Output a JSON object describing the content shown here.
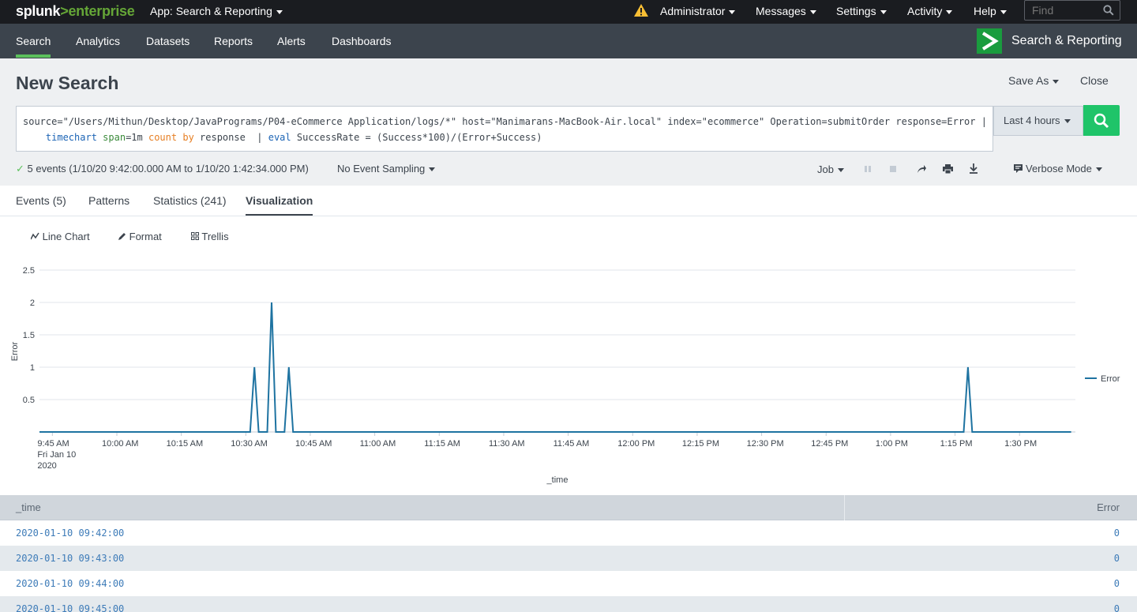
{
  "topbar": {
    "logo_splunk": "splunk",
    "logo_arrow": ">",
    "logo_enterprise": "enterprise",
    "app_label": "App: Search & Reporting",
    "menus": [
      "Administrator",
      "Messages",
      "Settings",
      "Activity",
      "Help"
    ],
    "find_placeholder": "Find",
    "warning_color": "#f8be34"
  },
  "appbar": {
    "nav": [
      "Search",
      "Analytics",
      "Datasets",
      "Reports",
      "Alerts",
      "Dashboards"
    ],
    "active_nav": "Search",
    "app_title": "Search & Reporting",
    "app_icon_color": "#1a9c3e"
  },
  "header": {
    "title": "New Search",
    "save_as": "Save As",
    "close": "Close"
  },
  "search": {
    "line1": "source=\"/Users/Mithun/Desktop/JavaPrograms/P04-eCommerce Application/logs/*\" host=\"Manimarans-MacBook-Air.local\" index=\"ecommerce\" Operation=submitOrder response=Error |",
    "line2_cmd1": "timechart",
    "line2_arg1": "span",
    "line2_val1": "=1m ",
    "line2_fn": "count",
    "line2_by": "by",
    "line2_rest1": " response  | ",
    "line2_cmd2": "eval",
    "line2_rest2": " SuccessRate = (Success*100)/(Error+Success)",
    "time_range": "Last 4 hours",
    "search_btn_color": "#1fc469"
  },
  "status": {
    "events": "5 events (1/10/20 9:42:00.000 AM to 1/10/20 1:42:34.000 PM)",
    "sampling": "No Event Sampling",
    "job": "Job",
    "mode": "Verbose Mode"
  },
  "tabs": [
    "Events (5)",
    "Patterns",
    "Statistics (241)",
    "Visualization"
  ],
  "active_tab": "Visualization",
  "viz": {
    "line_chart": "Line Chart",
    "format": "Format",
    "trellis": "Trellis"
  },
  "chart_data": {
    "type": "line",
    "ylabel": "Error",
    "xlabel": "_time",
    "ylim": [
      0,
      2.5
    ],
    "yticks": [
      "2.5",
      "2",
      "1.5",
      "1",
      "0.5"
    ],
    "xticks": [
      "9:45 AM",
      "10:00 AM",
      "10:15 AM",
      "10:30 AM",
      "10:45 AM",
      "11:00 AM",
      "11:15 AM",
      "11:30 AM",
      "11:45 AM",
      "12:00 PM",
      "12:15 PM",
      "12:30 PM",
      "12:45 PM",
      "1:00 PM",
      "1:15 PM",
      "1:30 PM"
    ],
    "first_tick_sub": [
      "Fri Jan 10",
      "2020"
    ],
    "legend": "right",
    "grid": true,
    "series": [
      {
        "name": "Error",
        "color": "#1e73a1",
        "points": [
          {
            "t": "09:42",
            "v": 0
          },
          {
            "t": "10:31",
            "v": 0
          },
          {
            "t": "10:32",
            "v": 1
          },
          {
            "t": "10:33",
            "v": 0
          },
          {
            "t": "10:35",
            "v": 0
          },
          {
            "t": "10:36",
            "v": 2
          },
          {
            "t": "10:37",
            "v": 0
          },
          {
            "t": "10:39",
            "v": 0
          },
          {
            "t": "10:40",
            "v": 1
          },
          {
            "t": "10:41",
            "v": 0
          },
          {
            "t": "13:17",
            "v": 0
          },
          {
            "t": "13:18",
            "v": 1
          },
          {
            "t": "13:19",
            "v": 0
          },
          {
            "t": "13:42",
            "v": 0
          }
        ]
      }
    ]
  },
  "table": {
    "columns": [
      "_time",
      "Error"
    ],
    "rows": [
      [
        "2020-01-10 09:42:00",
        "0"
      ],
      [
        "2020-01-10 09:43:00",
        "0"
      ],
      [
        "2020-01-10 09:44:00",
        "0"
      ],
      [
        "2020-01-10 09:45:00",
        "0"
      ]
    ]
  }
}
